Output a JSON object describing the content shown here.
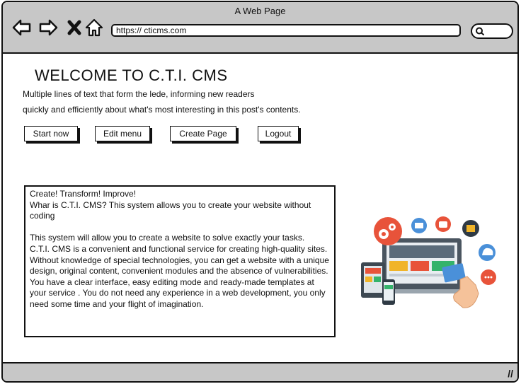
{
  "window": {
    "title": "A Web Page"
  },
  "address_bar": {
    "url": "https:// cticms.com"
  },
  "icons": {
    "back": "arrow-left-icon",
    "forward": "arrow-right-icon",
    "stop": "close-icon",
    "home": "home-icon",
    "search": "search-icon"
  },
  "page": {
    "heading": "WELCOME TO C.T.I. CMS",
    "lede_line_1": "Multiple lines of text that form the lede, informing new readers",
    "lede_line_2": "quickly and efficiently about what's most interesting in this post's contents.",
    "buttons": {
      "start": "Start now",
      "edit": "Edit menu",
      "create": "Create Page",
      "logout": "Logout"
    },
    "info": {
      "line1": "Create! Transform! Improve!",
      "line2": "Whar is C.T.I. CMS? This system allows you to create your website without coding",
      "line3": "This system will allow you to create a website to solve exactly your tasks.",
      "line4": "C.T.I. CMS is a convenient and functional service for creating high-quality sites. Without knowledge of special technologies, you can get a website with a unique design, original content, convenient modules and the absence of vulnerabilities. You have a clear interface, easy editing mode and ready-made templates at your service . You do not need any experience in a web development, you only need some time and your flight of imagination."
    },
    "illustration": "web-devices-illustration"
  }
}
